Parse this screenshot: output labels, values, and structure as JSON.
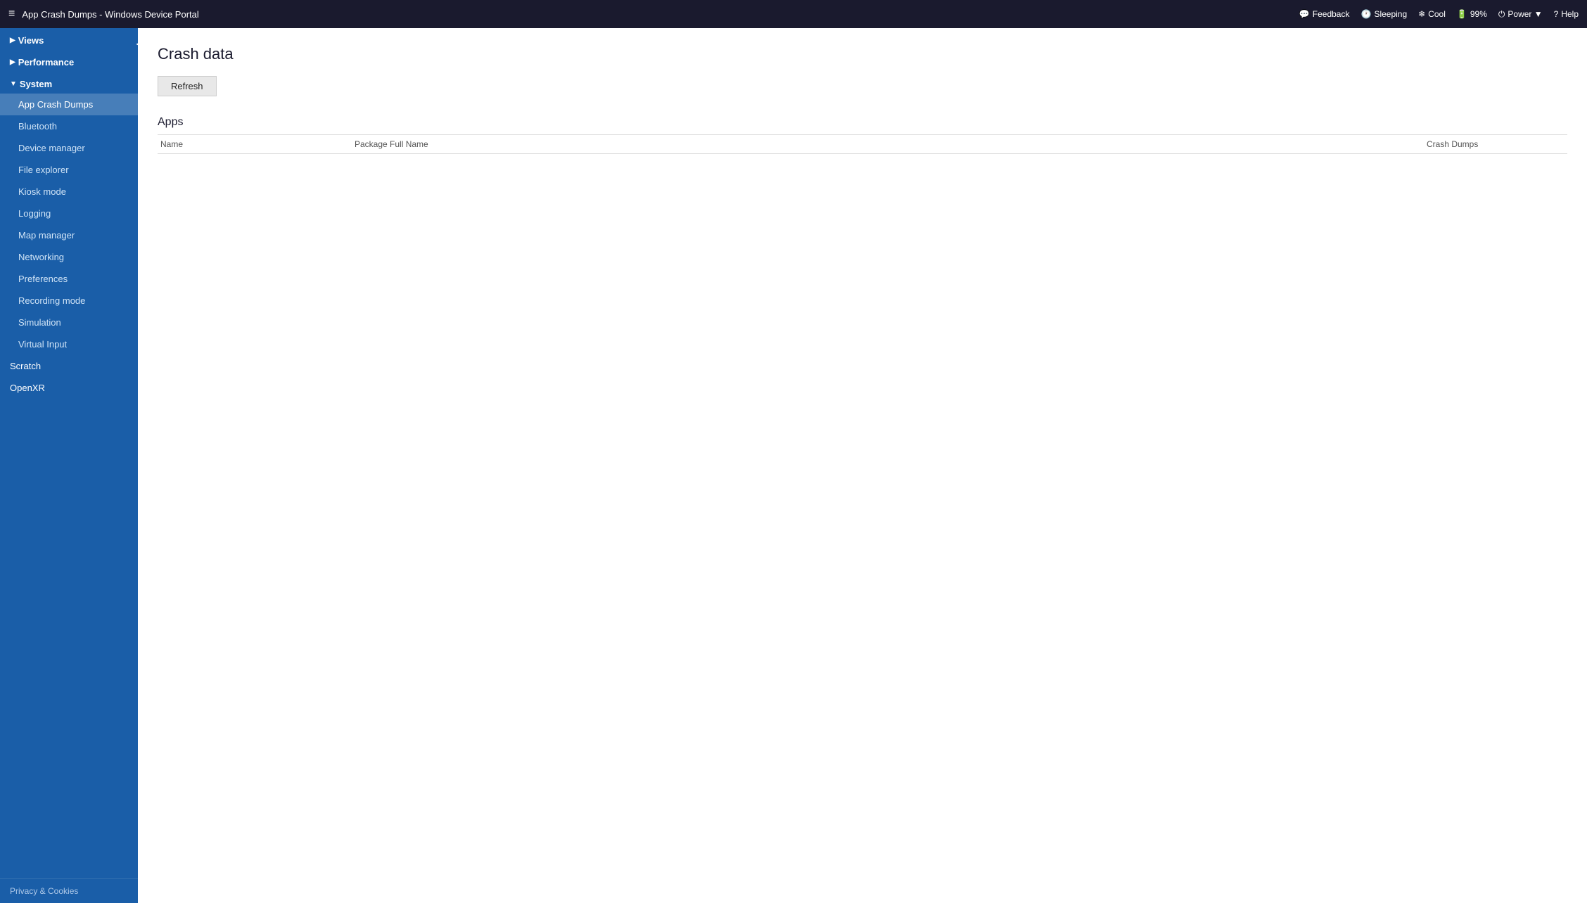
{
  "titlebar": {
    "menu_icon": "≡",
    "title": "App Crash Dumps - Windows Device Portal",
    "status_items": [
      {
        "id": "feedback",
        "icon": "💬",
        "label": "Feedback"
      },
      {
        "id": "sleeping",
        "icon": "🕐",
        "label": "Sleeping"
      },
      {
        "id": "cool",
        "icon": "❄",
        "label": "Cool"
      },
      {
        "id": "battery",
        "icon": "🔋",
        "label": "99%"
      },
      {
        "id": "power",
        "icon": "⏻",
        "label": "Power ▼"
      },
      {
        "id": "help",
        "icon": "?",
        "label": "Help"
      }
    ]
  },
  "sidebar": {
    "collapse_icon": "◀",
    "sections": [
      {
        "id": "views",
        "label": "Views",
        "arrow": "▶",
        "expanded": false,
        "items": []
      },
      {
        "id": "performance",
        "label": "Performance",
        "arrow": "▶",
        "expanded": false,
        "items": []
      },
      {
        "id": "system",
        "label": "System",
        "arrow": "▼",
        "expanded": true,
        "items": [
          {
            "id": "app-crash-dumps",
            "label": "App Crash Dumps",
            "active": true
          },
          {
            "id": "bluetooth",
            "label": "Bluetooth",
            "active": false
          },
          {
            "id": "device-manager",
            "label": "Device manager",
            "active": false
          },
          {
            "id": "file-explorer",
            "label": "File explorer",
            "active": false
          },
          {
            "id": "kiosk-mode",
            "label": "Kiosk mode",
            "active": false
          },
          {
            "id": "logging",
            "label": "Logging",
            "active": false
          },
          {
            "id": "map-manager",
            "label": "Map manager",
            "active": false
          },
          {
            "id": "networking",
            "label": "Networking",
            "active": false
          },
          {
            "id": "preferences",
            "label": "Preferences",
            "active": false
          },
          {
            "id": "recording-mode",
            "label": "Recording mode",
            "active": false
          },
          {
            "id": "simulation",
            "label": "Simulation",
            "active": false
          },
          {
            "id": "virtual-input",
            "label": "Virtual Input",
            "active": false
          }
        ]
      }
    ],
    "top_level_items": [
      {
        "id": "scratch",
        "label": "Scratch"
      },
      {
        "id": "openxr",
        "label": "OpenXR"
      }
    ],
    "footer": {
      "label": "Privacy & Cookies"
    }
  },
  "content": {
    "page_title": "Crash data",
    "refresh_button": "Refresh",
    "apps_section_title": "Apps",
    "table_columns": [
      {
        "id": "name",
        "label": "Name"
      },
      {
        "id": "package",
        "label": "Package Full Name"
      },
      {
        "id": "crash",
        "label": "Crash Dumps"
      }
    ]
  }
}
